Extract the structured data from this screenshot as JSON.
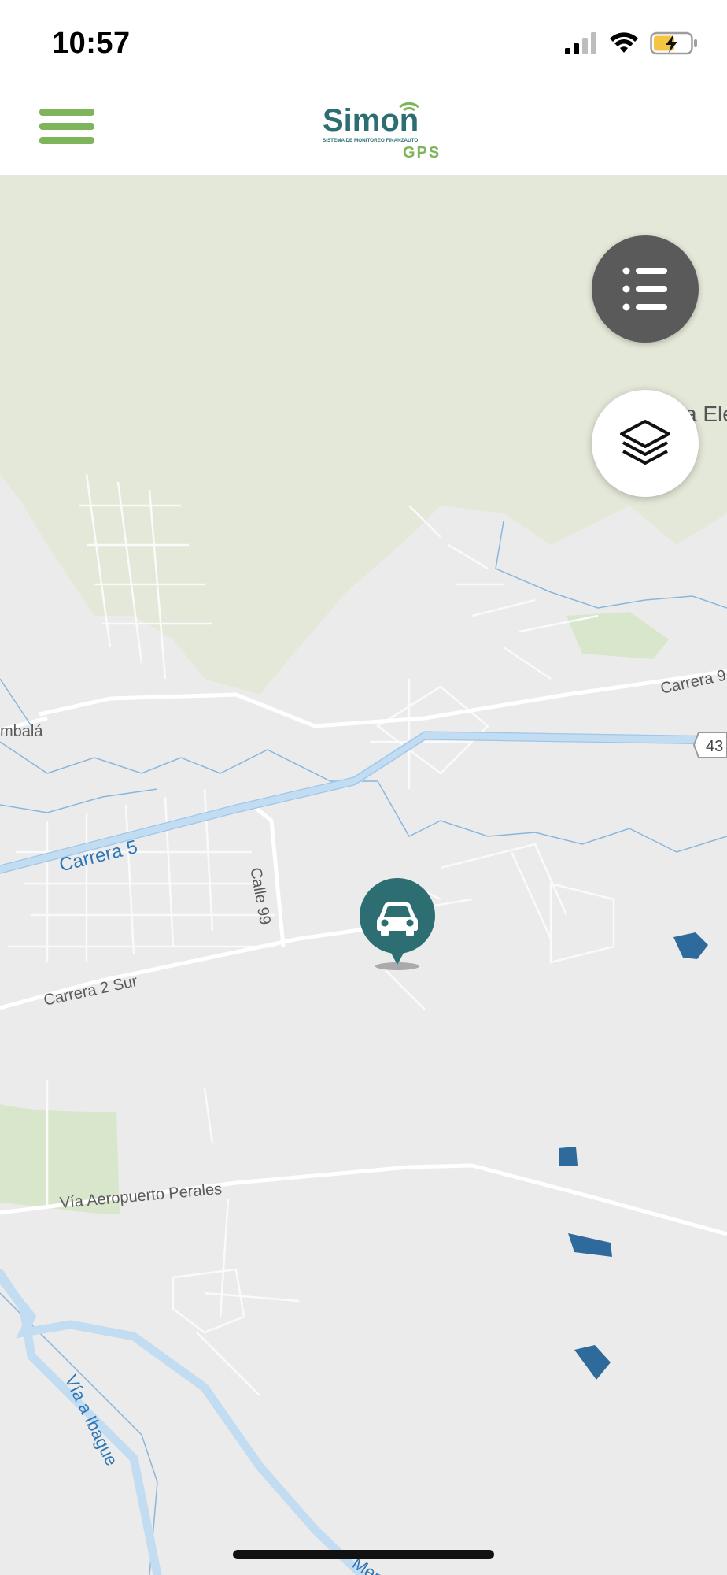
{
  "status_bar": {
    "time": "10:57"
  },
  "header": {
    "logo_text": "Simon",
    "logo_subtitle": "SISTEMA DE MONITOREO FINANZAUTO",
    "logo_gps": "GPS",
    "menu_icon": "hamburger-icon"
  },
  "map": {
    "street_labels": [
      "Carrera 9",
      "mbalá",
      "Calle 99",
      "Carrera 2 Sur",
      "Vía Aeropuerto Perales",
      "a Ele"
    ],
    "highway_labels": [
      "Carrera 5",
      "Vía a Ibague",
      "Mendi"
    ],
    "route_shield": "43",
    "vehicle_icon": "car-icon"
  },
  "controls": {
    "list_button_icon": "list-icon",
    "layers_button_icon": "layers-icon"
  },
  "colors": {
    "brand_green": "#7eb55a",
    "brand_teal": "#2c6e72",
    "map_background": "#ebebeb",
    "highway": "#c2dcf2",
    "polygon": "#2e6a9c"
  }
}
